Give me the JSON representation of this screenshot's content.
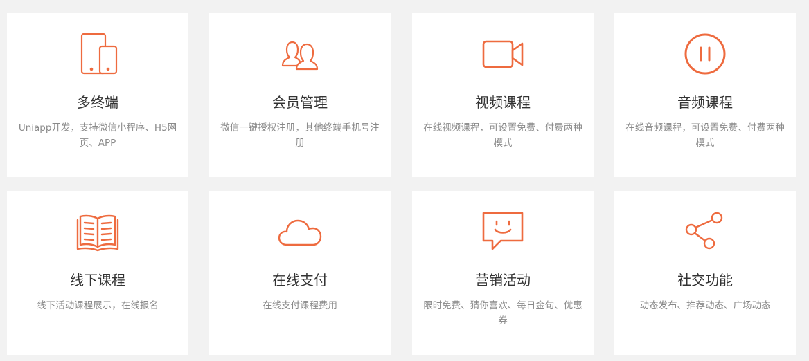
{
  "accent_color": "#ee6b3f",
  "features": [
    {
      "title": "多终端",
      "desc": "Uniapp开发，支持微信小程序、H5网页、APP",
      "icon": "devices-icon"
    },
    {
      "title": "会员管理",
      "desc": "微信一键授权注册，其他终端手机号注册",
      "icon": "users-icon"
    },
    {
      "title": "视频课程",
      "desc": "在线视频课程，可设置免费、付费两种模式",
      "icon": "video-camera-icon"
    },
    {
      "title": "音频课程",
      "desc": "在线音频课程，可设置免费、付费两种模式",
      "icon": "pause-circle-icon"
    },
    {
      "title": "线下课程",
      "desc": "线下活动课程展示，在线报名",
      "icon": "open-book-icon"
    },
    {
      "title": "在线支付",
      "desc": "在线支付课程费用",
      "icon": "cloud-icon"
    },
    {
      "title": "营销活动",
      "desc": "限时免费、猜你喜欢、每日金句、优惠券",
      "icon": "smile-chat-icon"
    },
    {
      "title": "社交功能",
      "desc": "动态发布、推荐动态、广场动态",
      "icon": "share-icon"
    }
  ]
}
